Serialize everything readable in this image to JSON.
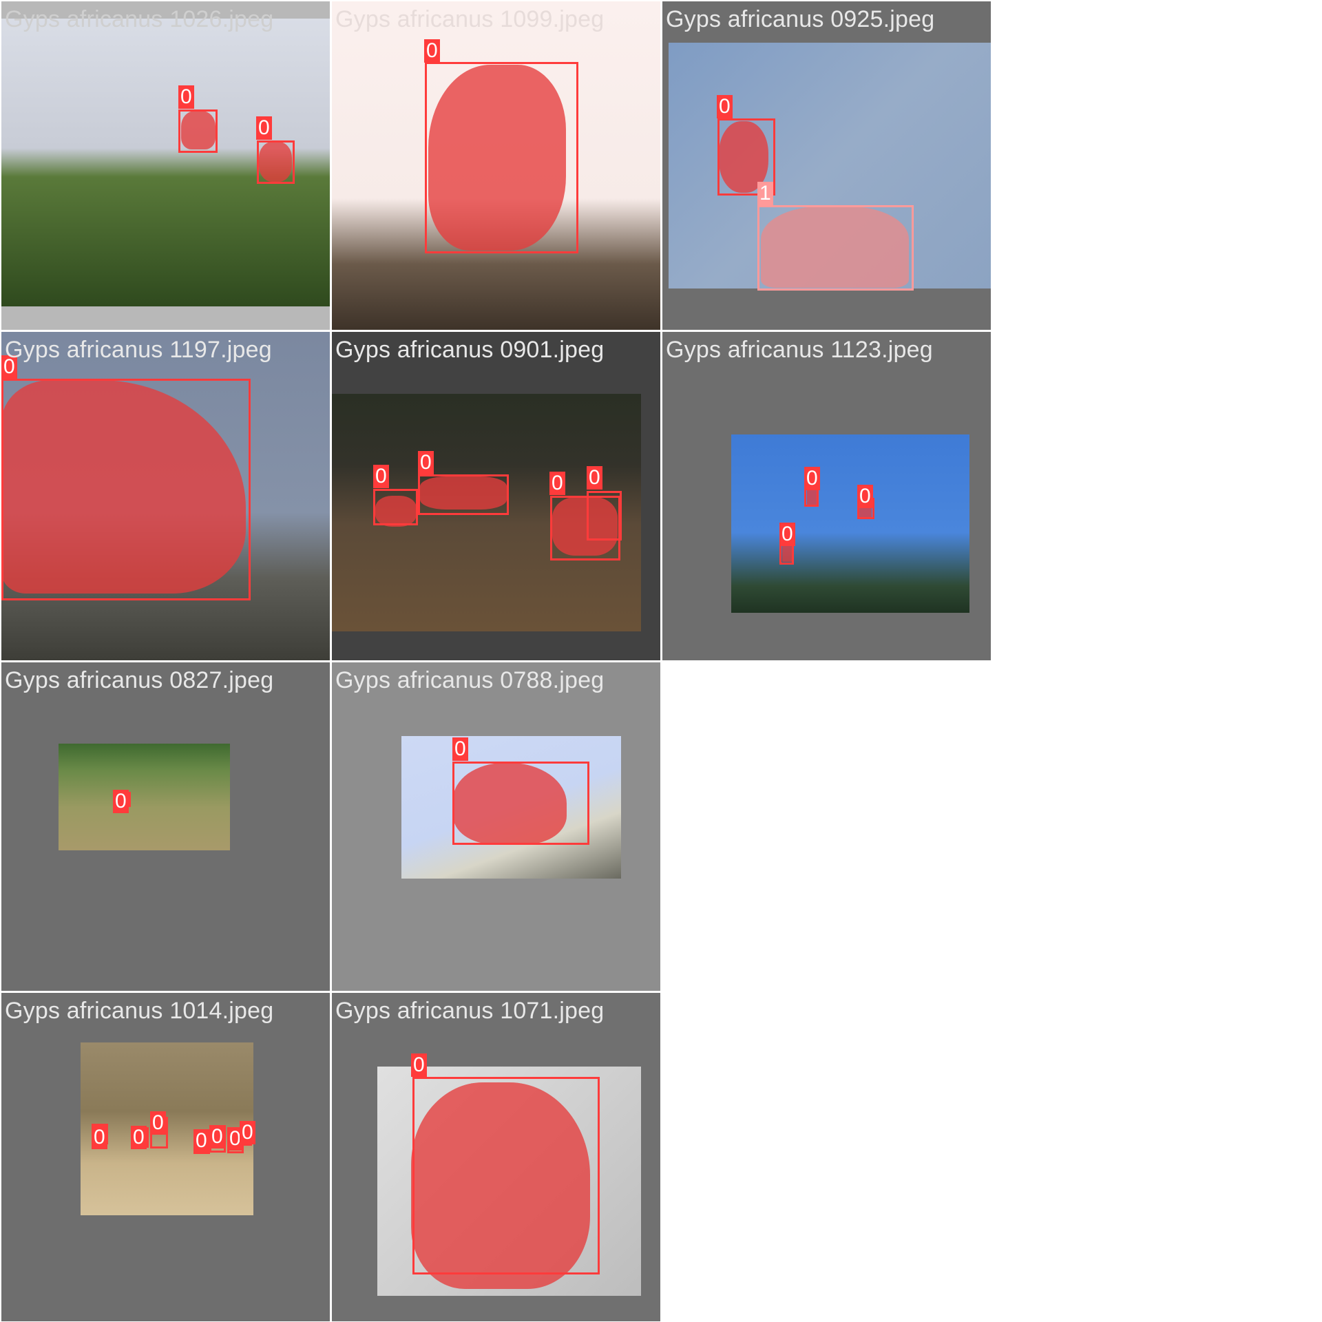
{
  "tiles": [
    {
      "title": "Gyps africanus 1026.jpeg",
      "labels": [
        "0",
        "0"
      ]
    },
    {
      "title": "Gyps africanus 1099.jpeg",
      "labels": [
        "0"
      ]
    },
    {
      "title": "Gyps africanus 0925.jpeg",
      "labels": [
        "0",
        "1"
      ]
    },
    {
      "title": "Gyps africanus 1197.jpeg",
      "labels": [
        "0"
      ]
    },
    {
      "title": "Gyps africanus 0901.jpeg",
      "labels": [
        "0",
        "0",
        "0",
        "0"
      ]
    },
    {
      "title": "Gyps africanus 1123.jpeg",
      "labels": [
        "0",
        "0",
        "0"
      ]
    },
    {
      "title": "Gyps africanus 0827.jpeg",
      "labels": [
        "0"
      ]
    },
    {
      "title": "Gyps africanus 0788.jpeg",
      "labels": [
        "0"
      ]
    },
    {
      "title": "Gyps africanus 1014.jpeg",
      "labels": [
        "0",
        "0",
        "0",
        "0",
        "0",
        "0",
        "0"
      ]
    },
    {
      "title": "Gyps africanus 1071.jpeg",
      "labels": [
        "0"
      ]
    }
  ],
  "colors": {
    "class_0": "#ff3b3b",
    "class_1": "#ff9a9a",
    "mask": "#e63c3c"
  }
}
